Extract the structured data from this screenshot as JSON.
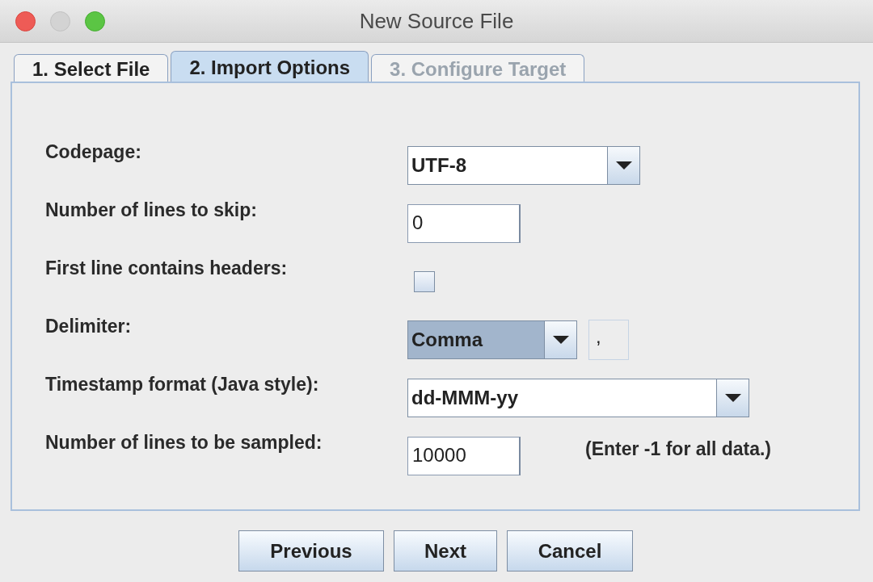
{
  "window": {
    "title": "New Source File"
  },
  "tabs": [
    {
      "label": "1. Select File",
      "selected": false,
      "disabled": false
    },
    {
      "label": "2. Import Options",
      "selected": true,
      "disabled": false
    },
    {
      "label": "3. Configure Target",
      "selected": false,
      "disabled": true
    }
  ],
  "rows": [
    {
      "kind": "combo",
      "label": "Codepage:",
      "value": "UTF-8"
    },
    {
      "kind": "text",
      "label": "Number of lines to skip:",
      "value": "0"
    },
    {
      "kind": "checkbox",
      "label": "First line contains headers:",
      "checked": false
    },
    {
      "kind": "delimiter",
      "label": "Delimiter:",
      "value": "Comma",
      "field_value": ","
    },
    {
      "kind": "editable-combo",
      "label": "Timestamp format (Java style):",
      "value": "dd-MMM-yy"
    },
    {
      "kind": "text",
      "label": "Number of lines to be sampled:",
      "value": "10000",
      "note": "(Enter -1 for all data.)"
    }
  ],
  "buttons": [
    "Previous",
    "Next",
    "Cancel"
  ]
}
